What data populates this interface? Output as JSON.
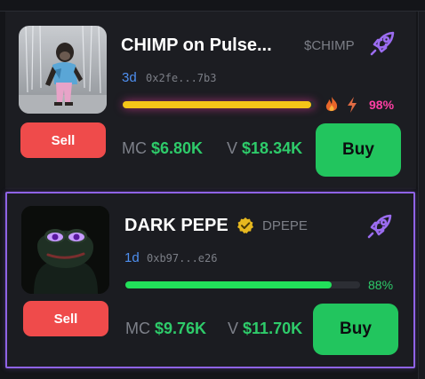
{
  "tokens": [
    {
      "name": "CHIMP on Pulse...",
      "ticker": "$CHIMP",
      "age": "3d",
      "address": "0x2fe...7b3",
      "progress_percent": 98,
      "progress_label": "98%",
      "progress_color": "#f5c518",
      "pct_color": "#ff3fa4",
      "badges": [
        "fire-icon",
        "lightning-icon"
      ],
      "mc_label": "MC",
      "mc_value": "$6.80K",
      "v_label": "V",
      "v_value": "$18.34K",
      "sell_label": "Sell",
      "buy_label": "Buy",
      "icon": "rocket-icon"
    },
    {
      "name": "DARK PEPE",
      "ticker": "DPEPE",
      "age": "1d",
      "address": "0xb97...e26",
      "progress_percent": 88,
      "progress_label": "88%",
      "progress_color": "#22e05a",
      "pct_color": "#2ecb6a",
      "verified": "verified-badge-icon",
      "mc_label": "MC",
      "mc_value": "$9.76K",
      "v_label": "V",
      "v_value": "$11.70K",
      "sell_label": "Sell",
      "buy_label": "Buy",
      "icon": "rocket-icon",
      "selected": true
    }
  ],
  "colors": {
    "accent_purple": "#8f63e6",
    "buy_green": "#22c55e",
    "sell_red": "#ef4b4b",
    "background": "#141519"
  }
}
